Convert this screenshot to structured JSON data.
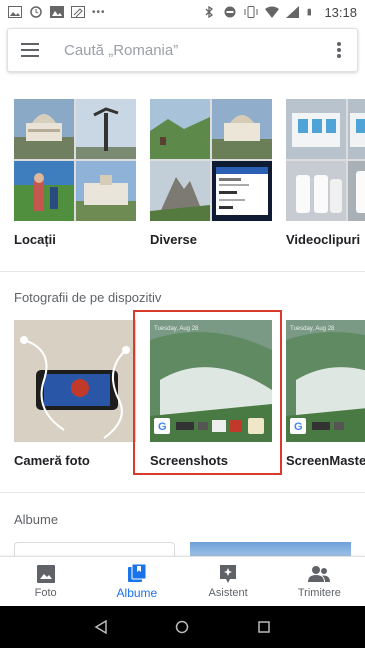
{
  "status_bar": {
    "time": "13:18",
    "left_icons": [
      "image-icon",
      "alarm-clock-icon",
      "gallery-icon",
      "edit-icon",
      "nfc-icon"
    ],
    "right_icons": [
      "bluetooth-icon",
      "dnd-icon",
      "vibrate-icon",
      "wifi-icon",
      "signal-icon",
      "battery-icon"
    ]
  },
  "search": {
    "placeholder": "Caută „Romania”"
  },
  "albums_row": [
    {
      "label": "Locații",
      "icon": "places-collage"
    },
    {
      "label": "Diverse",
      "icon": "things-collage"
    },
    {
      "label": "Videoclipuri",
      "icon": "videos-collage"
    }
  ],
  "device_section": {
    "title": "Fotografii de pe dispozitiv",
    "items": [
      {
        "label": "Cameră foto"
      },
      {
        "label": "Screenshots",
        "highlighted": true
      },
      {
        "label": "ScreenMaster"
      }
    ]
  },
  "albums_section": {
    "title": "Albume"
  },
  "bottom_nav": [
    {
      "label": "Foto",
      "icon": "photo-icon",
      "active": false
    },
    {
      "label": "Albume",
      "icon": "albums-icon",
      "active": true
    },
    {
      "label": "Asistent",
      "icon": "assistant-icon",
      "active": false
    },
    {
      "label": "Trimitere",
      "icon": "sharing-icon",
      "active": false
    }
  ],
  "colors": {
    "accent": "#1a73e8",
    "highlight_border": "#d93a2b"
  }
}
